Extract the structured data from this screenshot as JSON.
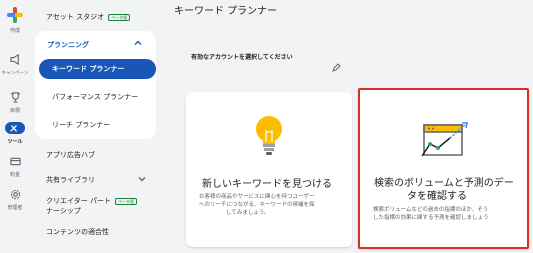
{
  "rail": {
    "create": "作成",
    "campaign": "キャンペーン",
    "goals": "目標",
    "tools": "ツール",
    "billing": "料金",
    "admin": "管理者"
  },
  "sidebar": {
    "asset_studio": "アセット スタジオ",
    "asset_studio_badge": "ベータ版",
    "planning": "プランニング",
    "keyword_planner": "キーワード プランナー",
    "performance_planner": "パフォーマンス プランナー",
    "reach_planner": "リーチ プランナー",
    "app_ad_hub": "アプリ広告ハブ",
    "shared_library": "共有ライブラリ",
    "creator_partnership_1": "クリエイター パート",
    "creator_partnership_2": "ナーシップ",
    "creator_badge": "ベータ版",
    "content_suitability": "コンテンツの適合性"
  },
  "main": {
    "title": "キーワード プランナー",
    "account_label": "有効なアカウントを選択してください"
  },
  "cards": {
    "discover": {
      "title": "新しいキーワードを見つける",
      "desc_1": "お客様の商品やサービスに関心を持つユーザー",
      "desc_2": "へのリーチにつながる、キーワードの候補を探",
      "desc_3": "してみましょう。"
    },
    "forecast": {
      "title_1": "検索のボリュームと予測のデー",
      "title_2": "タを確認する",
      "desc_1": "検索ボリュームなどの過去の指標のほか、そう",
      "desc_2": "した指標の効果に関する予測を確認しましょう"
    }
  },
  "colors": {
    "brand_blue": "#1a56b8",
    "highlight_red": "#d93025",
    "bulb_yellow": "#fbbc04",
    "beta_green": "#188038"
  }
}
